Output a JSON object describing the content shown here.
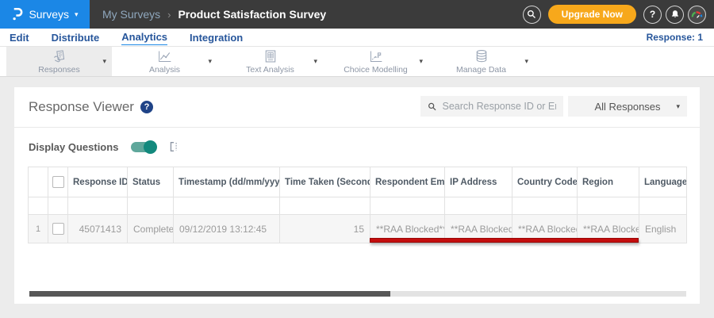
{
  "icons": {
    "caret_down": "▾",
    "sort_updown": "⇕",
    "breadcrumb_separator": "›",
    "help_glyph": "?"
  },
  "header": {
    "product_menu": "Surveys",
    "breadcrumb": {
      "parent": "My Surveys",
      "current": "Product Satisfaction Survey"
    },
    "upgrade_label": "Upgrade Now"
  },
  "nav": {
    "tabs": [
      {
        "label": "Edit"
      },
      {
        "label": "Distribute"
      },
      {
        "label": "Analytics"
      },
      {
        "label": "Integration"
      }
    ],
    "active_tab": "Analytics",
    "response_count": "Response: 1"
  },
  "toolbar": {
    "items": [
      {
        "label": "Responses",
        "icon": "responses-icon",
        "selected": true
      },
      {
        "label": "Analysis",
        "icon": "analysis-icon",
        "selected": false
      },
      {
        "label": "Text Analysis",
        "icon": "text-analysis-icon",
        "selected": false
      },
      {
        "label": "Choice Modelling",
        "icon": "choice-modelling-icon",
        "selected": false
      },
      {
        "label": "Manage Data",
        "icon": "manage-data-icon",
        "selected": false
      }
    ]
  },
  "viewer": {
    "title": "Response Viewer",
    "search_placeholder": "Search Response ID or Email",
    "responses_filter": "All Responses",
    "display_questions": "Display Questions",
    "display_questions_on": true
  },
  "table": {
    "headers": {
      "response_id": "Response ID",
      "status": "Status",
      "timestamp": "Timestamp (dd/mm/yyyy)",
      "time_taken": "Time Taken (Seconds)",
      "email": "Respondent Email",
      "ip": "IP Address",
      "country": "Country Code",
      "region": "Region",
      "language": "Language"
    },
    "rows": [
      {
        "num": "1",
        "response_id": "45071413",
        "status": "Completed",
        "timestamp": "09/12/2019 13:12:45",
        "time_taken": "15",
        "email": "**RAA Blocked**",
        "ip": "**RAA Blocked**",
        "country": "**RAA Blocked**",
        "region": "**RAA Blocked**",
        "language": "English"
      }
    ]
  },
  "colors": {
    "brand_blue": "#1b87e6",
    "header_dark": "#3b3b3b",
    "upgrade_orange": "#f7a81b",
    "nav_link_blue": "#27569b",
    "toggle_teal": "#13897d",
    "annotation_red": "#c40e0e"
  }
}
